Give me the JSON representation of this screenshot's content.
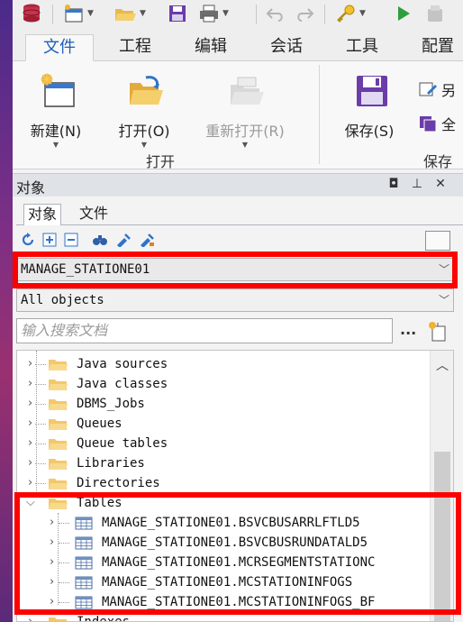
{
  "ribbon_tabs": [
    "文件",
    "工程",
    "编辑",
    "会话",
    "工具",
    "配置"
  ],
  "ribbon": {
    "new_label": "新建(N)",
    "open_label": "打开(O)",
    "reopen_label": "重新打开(R)",
    "save_label": "保存(S)",
    "group_open": "打开",
    "group_save": "保存",
    "small_btn_1": "另",
    "small_btn_2": "全"
  },
  "panel": {
    "title": "对象",
    "tab_objects": "对象",
    "tab_files": "文件",
    "schema_value": "MANAGE_STATIONE01",
    "filter_value": "All objects",
    "search_placeholder": "输入搜索文档",
    "search_opts": "...",
    "ctrl_float": "◘",
    "ctrl_pin": "⊥",
    "ctrl_close": "✕"
  },
  "tree": {
    "folders": [
      "Java sources",
      "Java classes",
      "DBMS_Jobs",
      "Queues",
      "Queue tables",
      "Libraries",
      "Directories"
    ],
    "tables_label": "Tables",
    "tables": [
      "MANAGE_STATIONE01.BSVCBUSARRLFTLD5",
      "MANAGE_STATIONE01.BSVCBUSRUNDATALD5",
      "MANAGE_STATIONE01.MCRSEGMENTSTATIONC",
      "MANAGE_STATIONE01.MCSTATIONINFOGS",
      "MANAGE_STATIONE01.MCSTATIONINFOGS_BF"
    ],
    "next_folder": "Indexes"
  },
  "colors": {
    "accent": "#1f5fb8",
    "highlight": "#ff0000",
    "folder": "#f3c86a"
  }
}
